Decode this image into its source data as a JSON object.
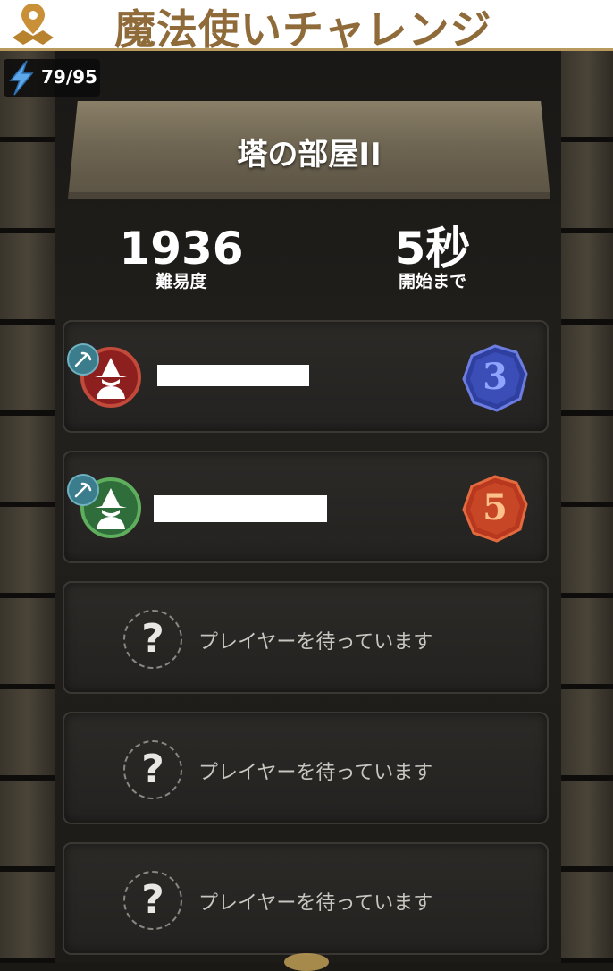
{
  "header": {
    "title": "魔法使いチャレンジ",
    "icon": "map-pin-icon"
  },
  "energy": {
    "value": "79/95",
    "icon": "lightning-bolt-icon"
  },
  "room": {
    "name": "塔の部屋II"
  },
  "stats": {
    "difficulty_value": "1936",
    "difficulty_label": "難易度",
    "countdown_value": "5秒",
    "countdown_label": "開始まで"
  },
  "players": [
    {
      "avatar_color": "#8e1f1f",
      "avatar_border": "#c24a3a",
      "rank": "3",
      "rank_color": "#2f3fa0"
    },
    {
      "avatar_color": "#2f6e3a",
      "avatar_border": "#5fae5e",
      "rank": "5",
      "rank_color": "#b7371f"
    }
  ],
  "waiting_slots": [
    {
      "symbol": "?",
      "text": "プレイヤーを待っています"
    },
    {
      "symbol": "?",
      "text": "プレイヤーを待っています"
    },
    {
      "symbol": "?",
      "text": "プレイヤーを待っています"
    }
  ]
}
